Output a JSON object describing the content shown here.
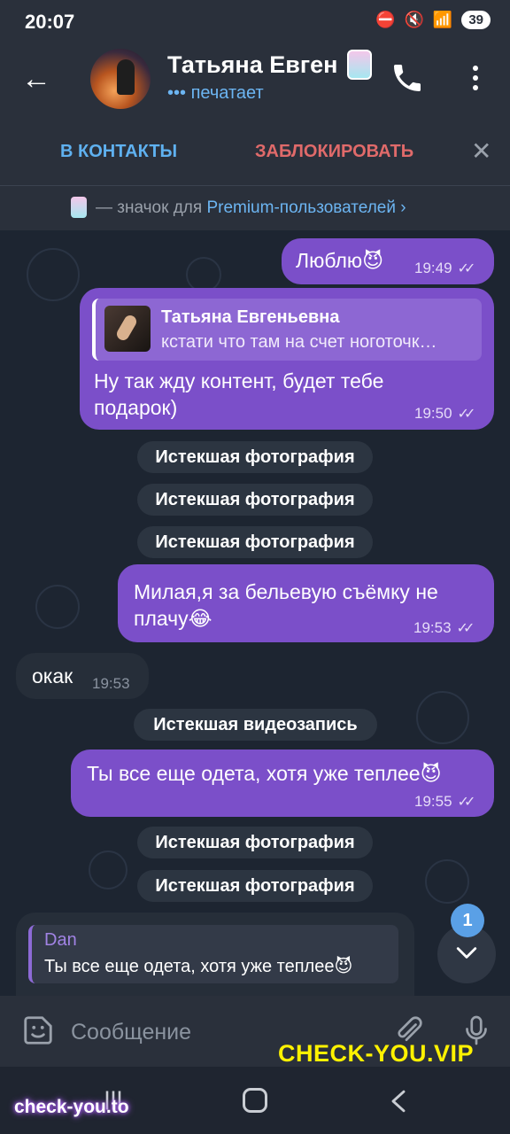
{
  "status_bar": {
    "time": "20:07",
    "battery": "39"
  },
  "header": {
    "contact_name": "Татьяна Евген",
    "status": "••• печатает"
  },
  "action_bar": {
    "add_contact": "В КОНТАКТЫ",
    "block": "ЗАБЛОКИРОВАТЬ"
  },
  "premium_bar": {
    "prefix": " — значок для ",
    "link": "Premium-пользователей",
    "chevron": "›"
  },
  "messages": [
    {
      "type": "out",
      "text": "Люблю😈",
      "time": "19:49",
      "read": "✓✓"
    },
    {
      "type": "out-reply",
      "reply_name": "Татьяна Евгеньевна",
      "reply_text": "кстати что там на счет ноготочк…",
      "text": "Ну так жду контент, будет тебе подарок)",
      "time": "19:50",
      "read": "✓✓"
    },
    {
      "type": "service",
      "text": "Истекшая фотография"
    },
    {
      "type": "service",
      "text": "Истекшая фотография"
    },
    {
      "type": "service",
      "text": "Истекшая фотография"
    },
    {
      "type": "out",
      "text": "Милая,я за бельевую съёмку не плачу😂",
      "time": "19:53",
      "read": "✓✓"
    },
    {
      "type": "in",
      "text": "окак",
      "time": "19:53"
    },
    {
      "type": "service",
      "text": "Истекшая видеозапись"
    },
    {
      "type": "out",
      "text": "Ты все еще одета, хотя уже теплее😈",
      "time": "19:55",
      "read": "✓✓"
    },
    {
      "type": "service",
      "text": "Истекшая фотография"
    },
    {
      "type": "service",
      "text": "Истекшая фотография"
    },
    {
      "type": "in-quote",
      "quote_name": "Dan",
      "quote_text": "Ты все еще одета, хотя уже теплее😈"
    }
  ],
  "scroll_down": {
    "unread_count": "1"
  },
  "input": {
    "placeholder": "Сообщение"
  },
  "watermarks": {
    "top": "CHECK-YOU.VIP",
    "bottom": "check-you.to"
  },
  "colors": {
    "accent": "#5fb1f0",
    "danger": "#e06a6a",
    "outgoing_bubble": "#7b4fc9",
    "incoming_bubble": "#262e39",
    "watermark": "#fff200"
  }
}
